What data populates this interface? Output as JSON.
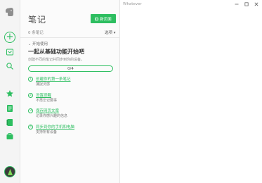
{
  "window": {
    "title": "Whatever"
  },
  "panel": {
    "title": "笔记",
    "new_button_label": "新页面",
    "count": "0 条笔记",
    "options": "选项 ▾"
  },
  "onboarding": {
    "section_label": "开始使用",
    "headline": "一起从基础功能开始吧",
    "subtitle": "创建不同的笔记并同步到你的设备。",
    "progress_text": "0/4",
    "progress_value": 0,
    "tasks": [
      {
        "number": "1",
        "title": "创建你的第一条笔记",
        "desc": "捕捉灵感"
      },
      {
        "number": "2",
        "title": "设置提醒",
        "desc": "不再忘记要事"
      },
      {
        "number": "3",
        "title": "保存网页文章",
        "desc": "记录你感兴趣的信息"
      },
      {
        "number": "4",
        "title": "同步到你的手机和电脑",
        "desc": "支持所有设备"
      }
    ]
  },
  "colors": {
    "accent": "#2dbe60"
  }
}
